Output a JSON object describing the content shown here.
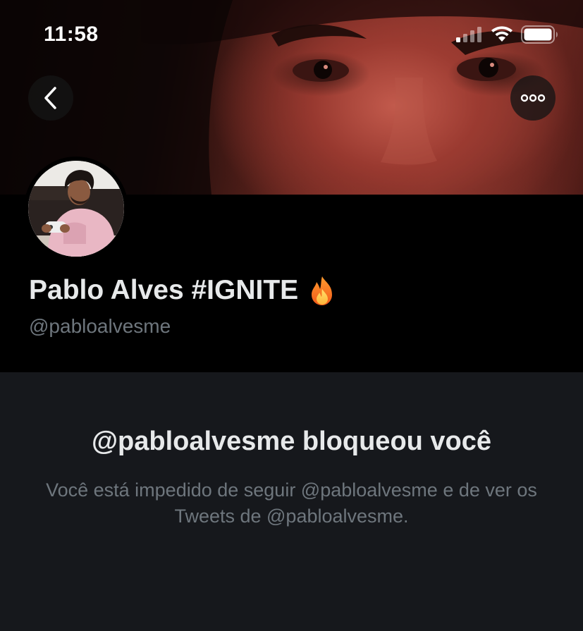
{
  "status_bar": {
    "time": "11:58",
    "icons": [
      "cellular-signal-icon",
      "wifi-icon",
      "battery-icon"
    ]
  },
  "nav": {
    "back_icon": "chevron-left-icon",
    "more_icon": "more-horizontal-icon"
  },
  "profile": {
    "display_name": "Pablo Alves #IGNITE",
    "name_emoji": "fire-emoji",
    "handle": "@pabloalvesme"
  },
  "blocked": {
    "title": "@pabloalvesme bloqueou você",
    "description": "Você está impedido de seguir @pabloalvesme e de ver os Tweets de @pabloalvesme."
  },
  "colors": {
    "background": "#000000",
    "panel": "#16181c",
    "primary_text": "#e7e9ea",
    "secondary_text": "#6e767d",
    "banner_red": "#9c4438"
  }
}
